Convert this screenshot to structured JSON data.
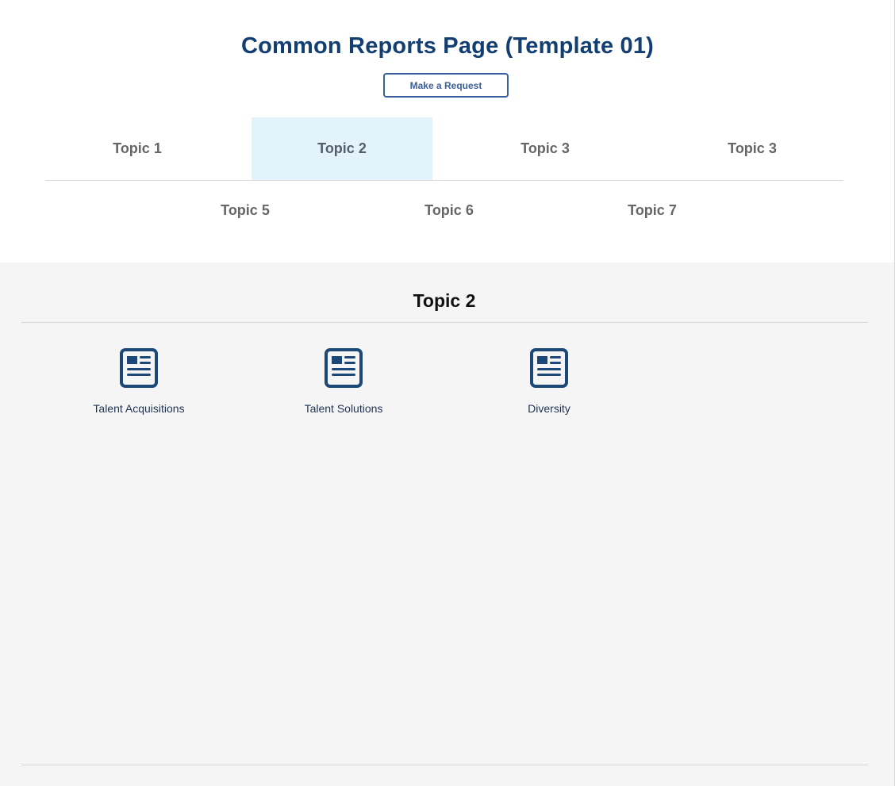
{
  "header": {
    "title": "Common Reports Page (Template 01)",
    "request_button_label": "Make a Request"
  },
  "tabs": [
    {
      "label": "Topic 1",
      "active": false
    },
    {
      "label": "Topic 2",
      "active": true
    },
    {
      "label": "Topic 3",
      "active": false
    },
    {
      "label": "Topic 3",
      "active": false
    },
    {
      "label": "Topic 5",
      "active": false
    },
    {
      "label": "Topic 6",
      "active": false
    },
    {
      "label": "Topic 7",
      "active": false
    }
  ],
  "section": {
    "title": "Topic 2",
    "reports": [
      {
        "label": "Talent Acquisitions",
        "icon": "report-document-icon"
      },
      {
        "label": "Talent Solutions",
        "icon": "report-document-icon"
      },
      {
        "label": "Diversity",
        "icon": "report-document-icon"
      }
    ]
  },
  "colors": {
    "brand_navy": "#123e72",
    "button_border": "#3b5f9a",
    "active_tab_bg": "#e3f3fb",
    "content_bg": "#f5f5f5",
    "icon_color": "#1b4878"
  }
}
